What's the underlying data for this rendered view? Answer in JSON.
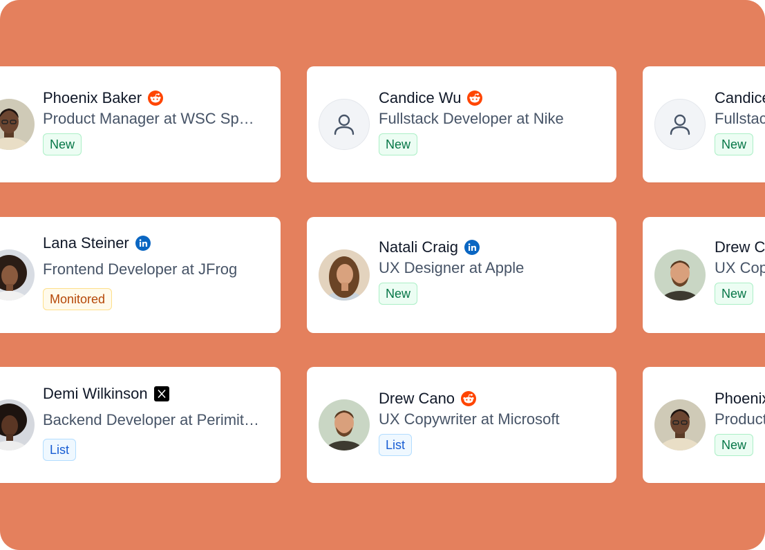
{
  "colors": {
    "background": "#E4805D",
    "card": "#FFFFFF",
    "name_text": "#101828",
    "title_text": "#475467",
    "badge_new": "#067647",
    "badge_monitored": "#B54708",
    "badge_list": "#175CD3",
    "reddit": "#FF4500",
    "linkedin": "#0A66C2",
    "x": "#000000"
  },
  "cards": [
    {
      "name": "Phoenix Baker",
      "title": "Product Manager at WSC Sp…",
      "source": "reddit-icon",
      "badge": "New",
      "avatar": "photo-man-beige-sweater"
    },
    {
      "name": "Candice Wu",
      "title": "Fullstack Developer at Nike",
      "source": "reddit-icon",
      "badge": "New",
      "avatar": "user-placeholder-icon"
    },
    {
      "name": "Candice",
      "title": "Fullstac",
      "source": "",
      "badge": "New",
      "avatar": "user-placeholder-icon"
    },
    {
      "name": "Lana Steiner",
      "title": "Frontend Developer at JFrog",
      "source": "linkedin-icon",
      "badge": "Monitored",
      "avatar": "photo-woman-curly-hair"
    },
    {
      "name": "Natali Craig",
      "title": "UX Designer at Apple",
      "source": "linkedin-icon",
      "badge": "New",
      "avatar": "photo-woman-long-hair"
    },
    {
      "name": "Drew C",
      "title": "UX Cop",
      "source": "",
      "badge": "New",
      "avatar": "photo-man-beard"
    },
    {
      "name": "Demi Wilkinson",
      "title": "Backend Developer at Perimit…",
      "source": "x-icon",
      "badge": "List",
      "avatar": "photo-woman-afro"
    },
    {
      "name": "Drew Cano",
      "title": "UX Copywriter at Microsoft",
      "source": "reddit-icon",
      "badge": "List",
      "avatar": "photo-man-beard"
    },
    {
      "name": "Phoenix",
      "title": "Product",
      "source": "",
      "badge": "New",
      "avatar": "photo-man-beige-sweater"
    }
  ]
}
